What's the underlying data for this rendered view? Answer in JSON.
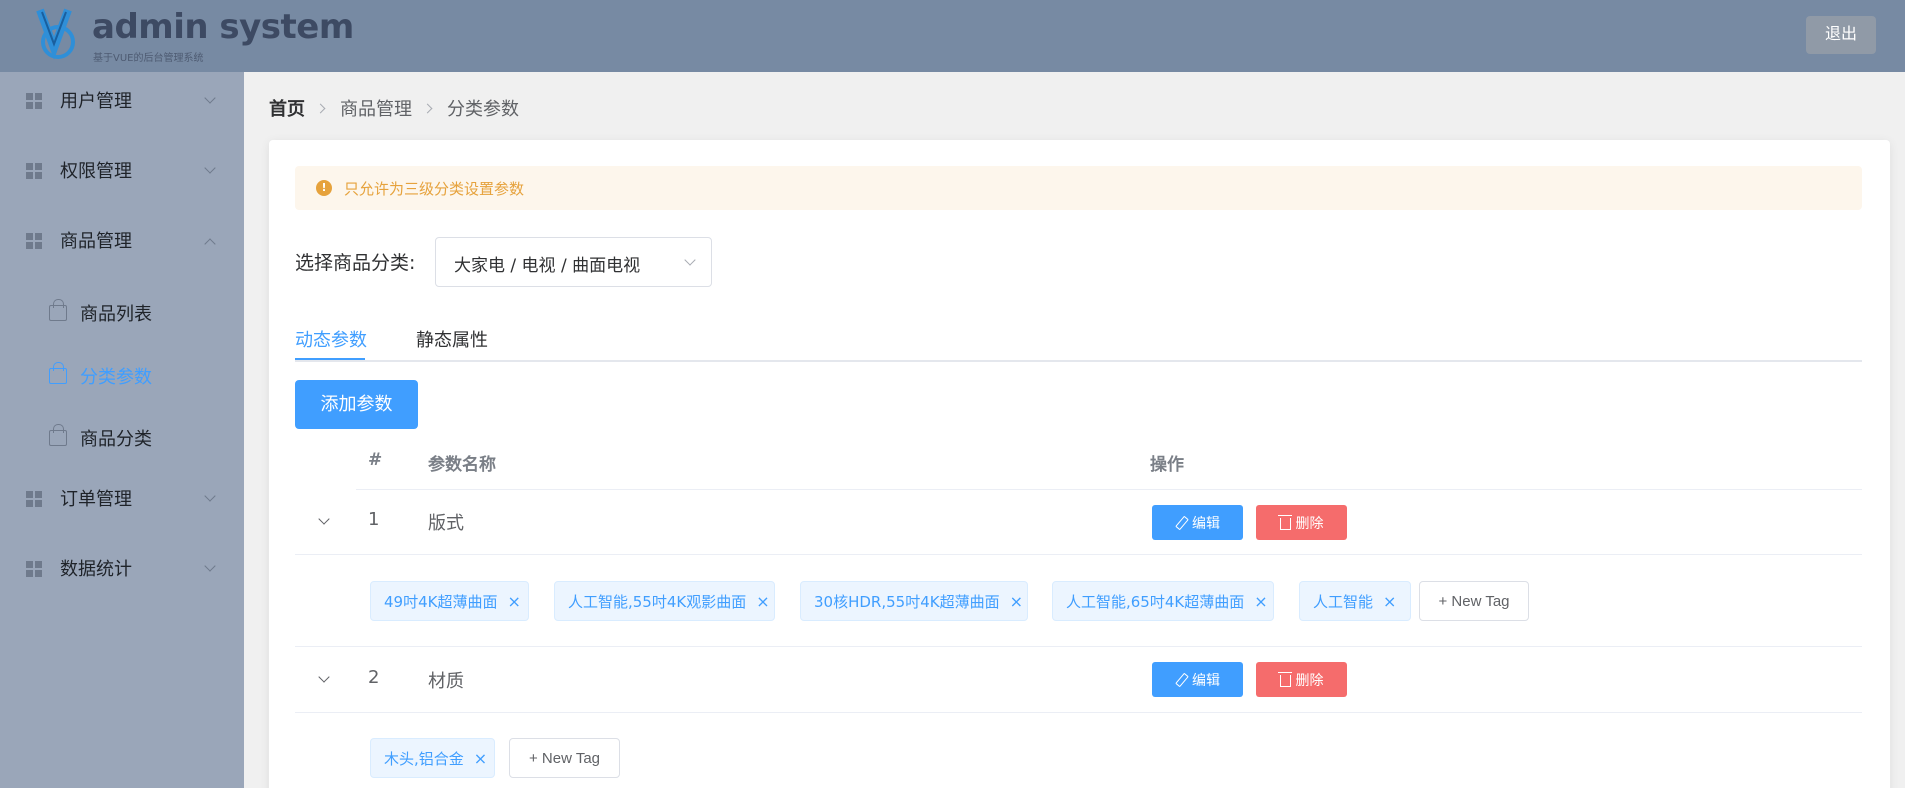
{
  "header": {
    "brand": "admin system",
    "subtitle": "基于VUE的后台管理系统",
    "logout_label": "退出"
  },
  "sidebar": {
    "items": [
      {
        "label": "用户管理",
        "icon": "grid-icon",
        "expanded": false
      },
      {
        "label": "权限管理",
        "icon": "grid-icon",
        "expanded": false
      },
      {
        "label": "商品管理",
        "icon": "grid-icon",
        "expanded": true
      },
      {
        "label": "订单管理",
        "icon": "grid-icon",
        "expanded": false
      },
      {
        "label": "数据统计",
        "icon": "grid-icon",
        "expanded": false
      }
    ],
    "subitems": [
      {
        "label": "商品列表",
        "icon": "bag-icon",
        "active": false
      },
      {
        "label": "分类参数",
        "icon": "bag-icon",
        "active": true
      },
      {
        "label": "商品分类",
        "icon": "bag-icon",
        "active": false
      }
    ]
  },
  "breadcrumb": [
    "首页",
    "商品管理",
    "分类参数"
  ],
  "alert": {
    "text": "只允许为三级分类设置参数",
    "icon": "warning-icon",
    "color": "#e6a23c"
  },
  "category": {
    "label": "选择商品分类:",
    "value": "大家电 / 电视 / 曲面电视"
  },
  "tabs": [
    {
      "label": "动态参数",
      "active": true
    },
    {
      "label": "静态属性",
      "active": false
    }
  ],
  "add_button": "添加参数",
  "table": {
    "headers": [
      "#",
      "参数名称",
      "操作"
    ],
    "edit_label": "编辑",
    "delete_label": "删除",
    "new_tag_label": "+ New Tag",
    "rows": [
      {
        "index": "1",
        "name": "版式",
        "tags": [
          "49吋4K超薄曲面",
          "人工智能,55吋4K观影曲面",
          "30核HDR,55吋4K超薄曲面",
          "人工智能,65吋4K超薄曲面",
          "人工智能"
        ]
      },
      {
        "index": "2",
        "name": "材质",
        "tags": [
          "木头,铝合金"
        ]
      }
    ]
  },
  "colors": {
    "primary": "#409eff",
    "danger": "#f56c6c",
    "header_bg": "#778aa3",
    "sidebar_bg": "#9aa6b9"
  }
}
